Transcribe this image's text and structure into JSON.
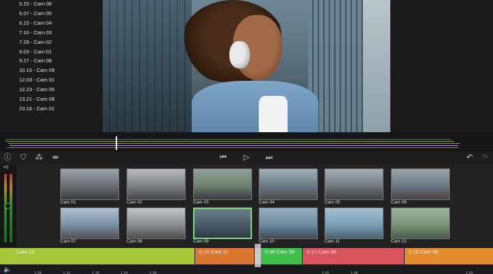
{
  "markers": [
    "5.20 - Cam 06",
    "6.07 - Cam 05",
    "6.23 - Cam 04",
    "7.10 - Cam 03",
    "7.29 - Cam 02",
    "9.03 - Cam 01",
    "9.27 - Cam 08",
    "10.15 - Cam 09",
    "12.03 - Cam 01",
    "12.23 - Cam 05",
    "13.21 - Cam 09",
    "23.16 - Cam 01"
  ],
  "toolbar": {
    "info_icon": "info-icon",
    "marker_icon": "marker-icon",
    "magic_icon": "magic-wand-icon",
    "split_icon": "split-icon",
    "prev_icon": "skip-back-icon",
    "play_icon": "play-icon",
    "next_icon": "skip-forward-icon",
    "undo_icon": "undo-icon",
    "redo_icon": "redo-icon"
  },
  "meter": {
    "level_label": "+0"
  },
  "cameras": [
    "Cam 01",
    "Cam 02",
    "Cam 03",
    "Cam 04",
    "Cam 05",
    "Cam 06",
    "Cam 07",
    "Cam 08",
    "Cam 09",
    "Cam 10",
    "Cam 11",
    "Cam 12"
  ],
  "camera_colors": {
    "Cam 01": "#7a7a7a",
    "Cam 02": "#7a7a7a",
    "Cam 03": "#7a7a7a",
    "Cam 04": "#7a7a7a",
    "Cam 05": "#7a7a7a",
    "Cam 06": "#7a7a7a",
    "Cam 07": "#7a7a7a",
    "Cam 08": "#7a7a7a",
    "Cam 09": "#7fdc7f",
    "Cam 10": "#7a7a7a",
    "Cam 11": "#7a7a7a",
    "Cam 12": "#7a7a7a"
  },
  "selected_camera": "Cam 09",
  "timeline_clips": [
    {
      "label": "Cam 10",
      "color": "#a8c83a"
    },
    {
      "label": "0.10 Cam 11",
      "color": "#d9772f"
    },
    {
      "label": "",
      "color": "#c9c9c9"
    },
    {
      "label": "0.08 Cam 09",
      "color": "#3ebf4a"
    },
    {
      "label": "0.17 Cam 06",
      "color": "#d9545d"
    },
    {
      "label": "0.16 Cam 05",
      "color": "#e58b2d"
    }
  ],
  "ruler_ticks": [
    "1.04",
    "1.12",
    "1.18",
    "1.24",
    "1.30",
    "",
    "",
    "",
    "",
    "",
    "1.42",
    "1.48",
    "",
    "",
    "",
    "1.60"
  ]
}
